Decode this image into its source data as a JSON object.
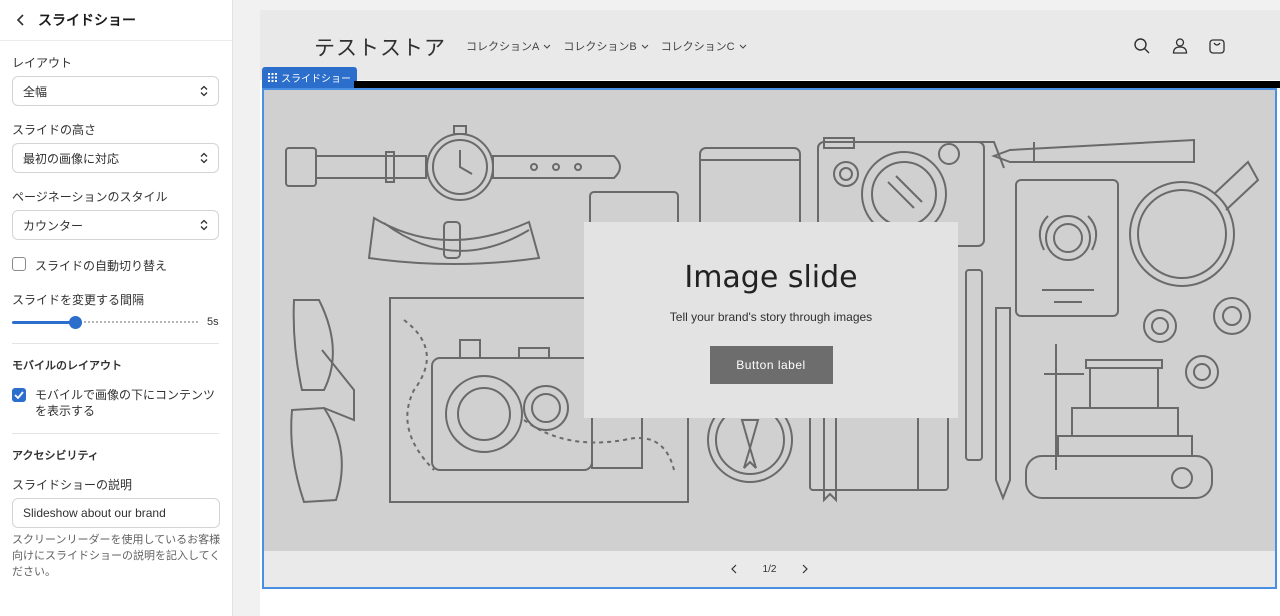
{
  "sidebar": {
    "title": "スライドショー",
    "layout": {
      "label": "レイアウト",
      "value": "全幅"
    },
    "slide_height": {
      "label": "スライドの高さ",
      "value": "最初の画像に対応"
    },
    "pagination": {
      "label": "ページネーションのスタイル",
      "value": "カウンター"
    },
    "autoplay": {
      "label": "スライドの自動切り替え",
      "checked": false
    },
    "interval": {
      "label": "スライドを変更する間隔",
      "value": "5s",
      "level": 0.33
    },
    "mobile_section": "モバイルのレイアウト",
    "mobile_stack": {
      "label": "モバイルで画像の下にコンテンツを表示する",
      "checked": true
    },
    "a11y_section": "アクセシビリティ",
    "description": {
      "label": "スライドショーの説明",
      "value": "Slideshow about our brand",
      "help": "スクリーンリーダーを使用しているお客様向けにスライドショーの説明を記入してください。"
    }
  },
  "store": {
    "name": "テストストア",
    "nav": [
      "コレクションA",
      "コレクションB",
      "コレクションC"
    ],
    "icons": [
      "search-icon",
      "account-icon",
      "cart-icon"
    ]
  },
  "section_tag": "スライドショー",
  "slide": {
    "heading": "Image slide",
    "text": "Tell your brand's story through images",
    "button": "Button label"
  },
  "pagination_counter": "1/2",
  "colors": {
    "accent": "#2c6ecb",
    "selection": "#4a90e2",
    "button": "#6d6d6d",
    "slide_bg": "#d0d0d0"
  }
}
